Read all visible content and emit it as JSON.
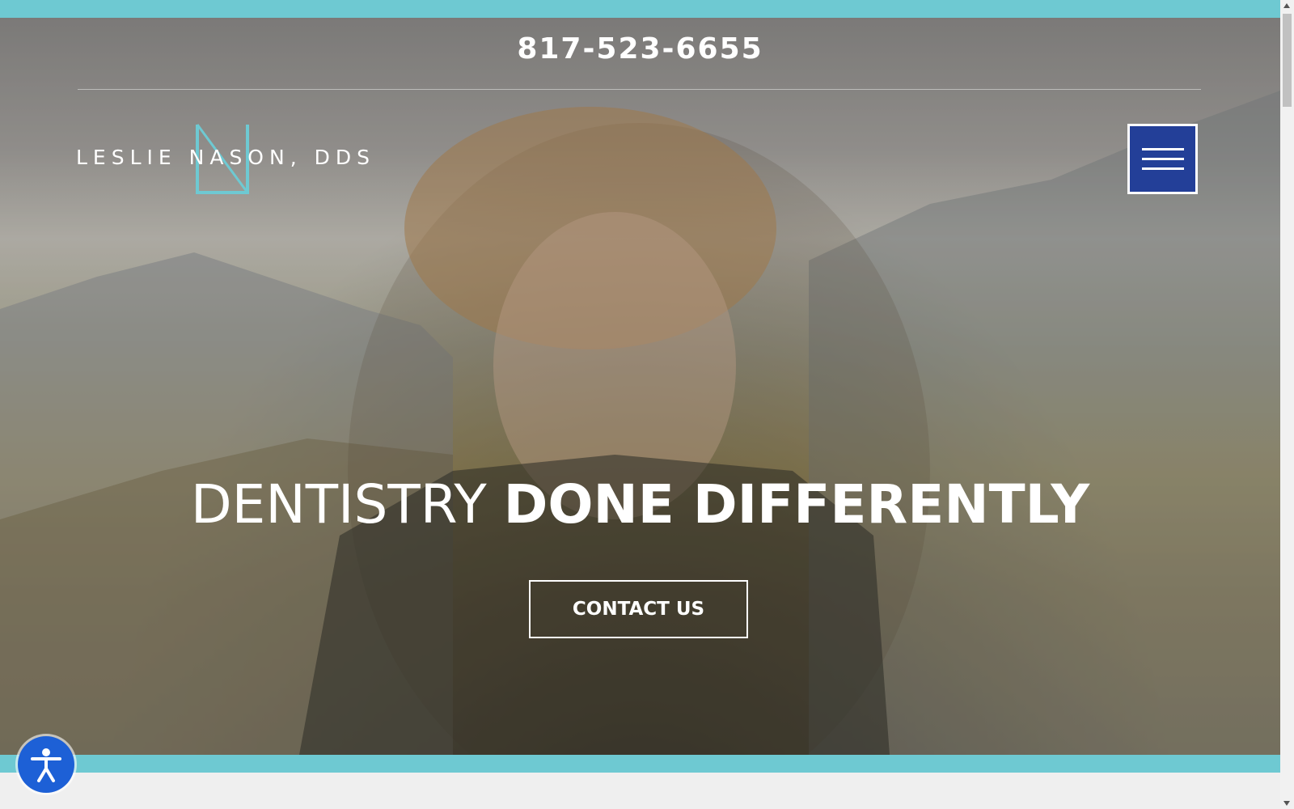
{
  "header": {
    "phone": "817-523-6655",
    "logo_text": "LESLIE NASON, DDS",
    "menu_icon": "hamburger-menu-icon"
  },
  "hero": {
    "headline_light": "DENTISTRY",
    "headline_bold": "DONE DIFFERENTLY",
    "cta_label": "CONTACT US"
  },
  "widgets": {
    "accessibility_icon": "accessibility-person-icon"
  },
  "colors": {
    "accent_teal": "#6ec9d2",
    "menu_blue": "#233f98",
    "accessibility_blue": "#1d60d6"
  }
}
